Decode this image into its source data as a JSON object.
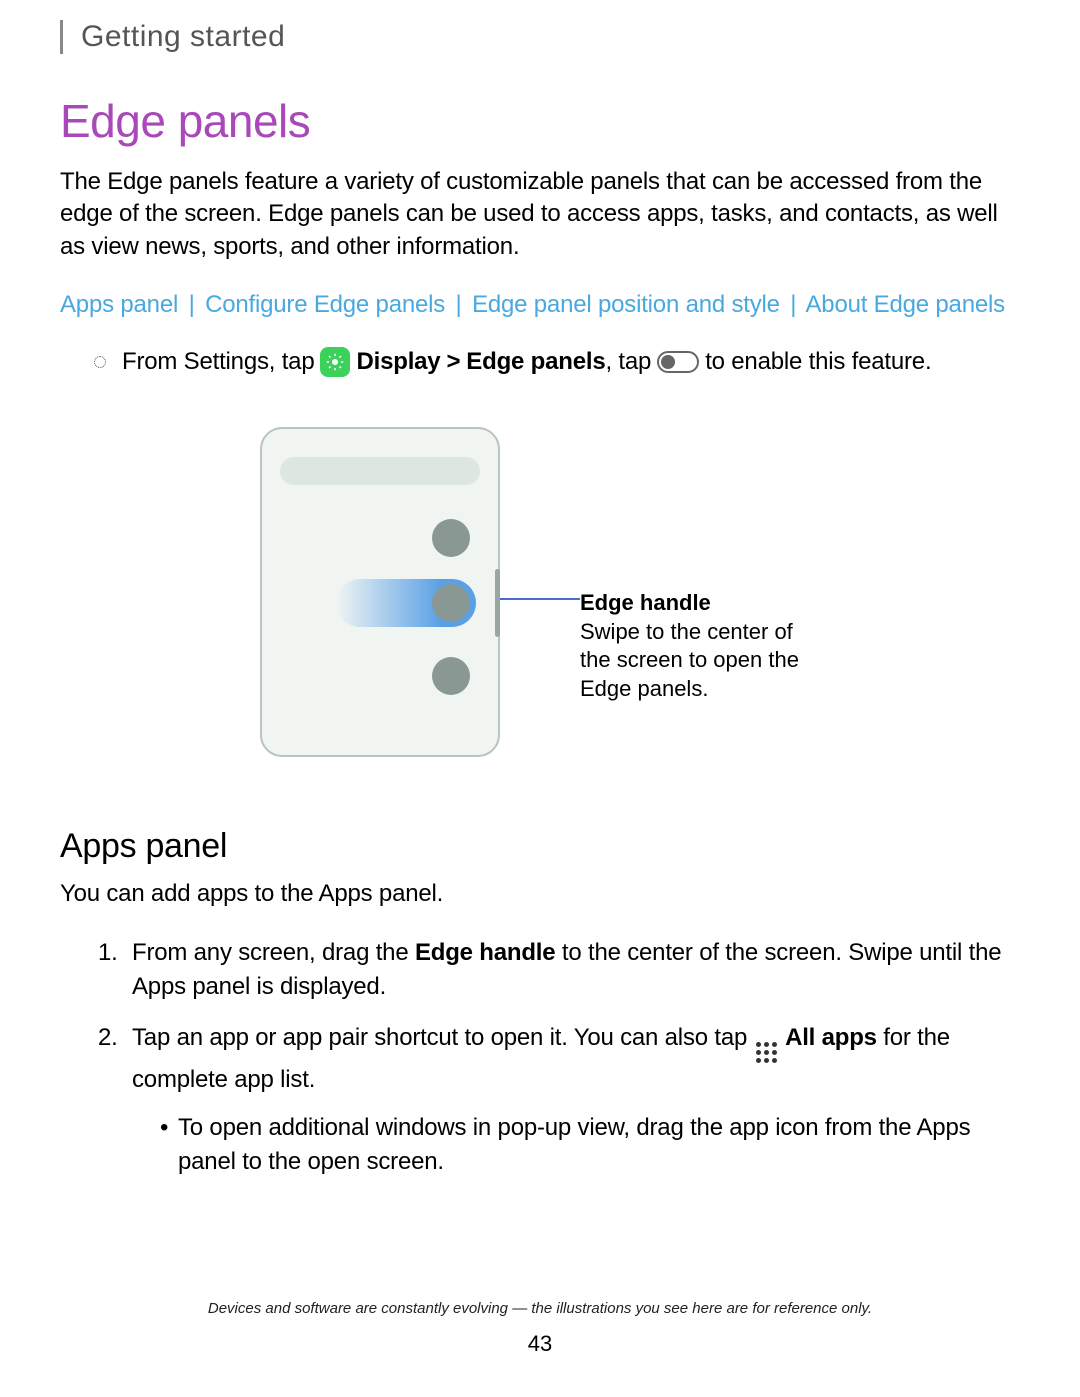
{
  "breadcrumb": "Getting started",
  "title": "Edge panels",
  "intro": "The Edge panels feature a variety of customizable panels that can be accessed from the edge of the screen. Edge panels can be used to access apps, tasks, and contacts, as well as view news, sports, and other information.",
  "links": [
    "Apps panel",
    "Configure Edge panels",
    "Edge panel position and style",
    "About Edge panels"
  ],
  "sep": "|",
  "step": {
    "pre": "From Settings, tap",
    "display": "Display",
    "gt": ">",
    "edge": "Edge panels",
    "mid": ", tap",
    "post": "to enable this feature."
  },
  "annotation": {
    "title": "Edge handle",
    "body": "Swipe to the center of the screen to open the Edge panels."
  },
  "section": {
    "heading": "Apps panel",
    "desc": "You can add apps to the Apps panel.",
    "step1_a": "From any screen, drag the ",
    "step1_b": "Edge handle",
    "step1_c": " to the center of the screen. Swipe until the Apps panel is displayed.",
    "step2_a": "Tap an app or app pair shortcut to open it. You can also tap",
    "step2_b": "All apps",
    "step2_c": " for the complete app list.",
    "sub1": "To open additional windows in pop-up view, drag the app icon from the Apps panel to the open screen."
  },
  "footer": {
    "note": "Devices and software are constantly evolving — the illustrations you see here are for reference only.",
    "page": "43"
  }
}
